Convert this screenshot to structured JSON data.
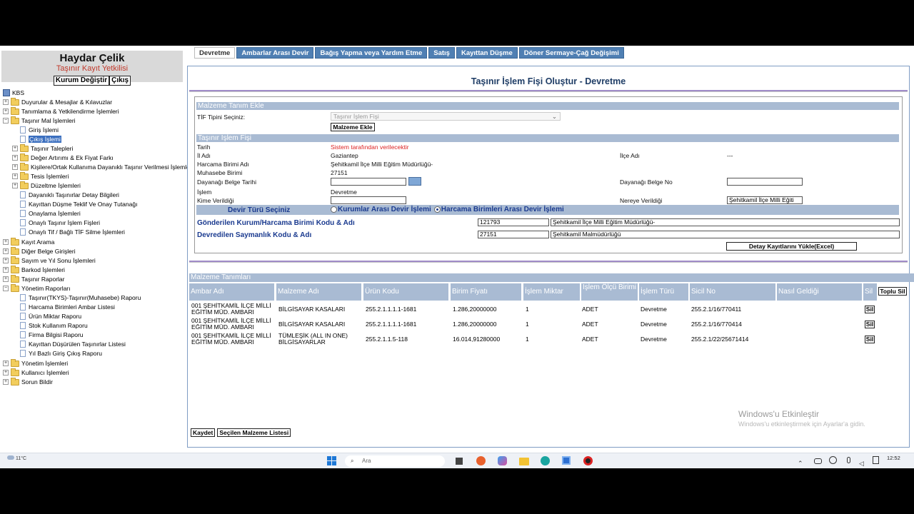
{
  "user": {
    "name": "Haydar Çelik",
    "role": "Taşınır Kayıt Yetkilisi",
    "change_org": "Kurum Değiştir",
    "logout": "Çıkış"
  },
  "tree": {
    "root": "KBS",
    "items": [
      "Duyurular & Mesajlar & Kılavuzlar",
      "Tanımlama & Yetkilendirme İşlemleri",
      "Taşınır Mal İşlemleri",
      "Giriş İşlemi",
      "Çıkış İşlemi",
      "Taşınır Talepleri",
      "Değer Artırımı & Ek Fiyat Farkı",
      "Kişilere/Ortak Kullanıma Dayanıklı Taşınır Verilmesi İşlemleri",
      "Tesis İşlemleri",
      "Düzeltme İşlemleri",
      "Dayanıklı Taşınırlar Detay Bilgileri",
      "Kayıttan Düşme Teklif Ve Onay Tutanağı",
      "Onaylama İşlemleri",
      "Onaylı Taşınır İşlem Fişleri",
      "Onaylı Tif / Bağlı TİF Silme İşlemleri",
      "Kayıt Arama",
      "Diğer Belge Girişleri",
      "Sayım ve Yıl Sonu İşlemleri",
      "Barkod İşlemleri",
      "Taşınır Raporlar",
      "Yönetim Raporları",
      "Taşınır(TKYS)-Taşınır(Muhasebe) Raporu",
      "Harcama Birimleri Ambar Listesi",
      "Ürün Miktar Raporu",
      "Stok Kullanım Raporu",
      "Firma Bilgisi Raporu",
      "Kayıttan Düşürülen Taşınırlar Listesi",
      "Yıl Bazlı Giriş Çıkış Raporu",
      "Yönetim İşlemleri",
      "Kullanıcı İşlemleri",
      "Sorun Bildir"
    ]
  },
  "tabs": [
    "Devretme",
    "Ambarlar Arası Devir",
    "Bağış Yapma veya Yardım Etme",
    "Satış",
    "Kayıttan Düşme",
    "Döner Sermaye-Çağ Değişimi"
  ],
  "form": {
    "title": "Taşınır İşlem Fişi Oluştur - Devretme",
    "sec1": "Malzeme Tanım Ekle",
    "tif_label": "TİF Tipini Seçiniz:",
    "tif_value": "Taşınır İşlem Fişi",
    "add_material": "Malzeme Ekle",
    "sec2": "Taşınır İşlem Fişi",
    "date_label": "Tarih",
    "date_value": "Sistem tarafından verilecektir",
    "city_label": "İl Adı",
    "city_value": "Gaziantep",
    "district_label": "İlçe Adı",
    "district_value": "---",
    "unit_label": "Harcama Birimi Adı",
    "unit_value": "Şehitkamil İlçe Milli Eğitim Müdürlüğü-",
    "acc_label": "Muhasebe Birimi",
    "acc_value": "27151",
    "docdate_label": "Dayanağı Belge Tarihi",
    "docno_label": "Dayanağı Belge No",
    "op_label": "İşlem",
    "op_value": "Devretme",
    "given_label": "Kime Verildiği",
    "where_label": "Nereye Verildiği",
    "where_value": "Şehitkamil İlçe Milli Eğiti",
    "transfer_label": "Devir Türü Seçiniz",
    "radio1": "Kurumlar Arası Devir İşlemi",
    "radio2": "Harcama Birimleri Arası Devir İşlemi",
    "sender_label": "Gönderilen Kurum/Harcama Birimi Kodu & Adı",
    "sender_code": "121793",
    "sender_name": "Şehitkamil İlçe Milli Eğitim Müdürlüğü-",
    "office_label": "Devredilen Saymanlık Kodu & Adı",
    "office_code": "27151",
    "office_name": "Şehitkamil Malmüdürlüğü",
    "excel_btn": "Detay Kayıtlarını Yükle(Excel)"
  },
  "table": {
    "title": "Malzeme Tanımları",
    "headers": [
      "Ambar Adı",
      "Malzeme Adı",
      "Ürün Kodu",
      "Birim Fiyatı",
      "İşlem Miktar",
      "İşlem Ölçü Birimi",
      "İşlem Türü",
      "Sicil No",
      "Nasıl Geldiği",
      "Sil"
    ],
    "bulk_delete": "Toplu Sil",
    "delete_label": "Sil",
    "rows": [
      [
        "001 ŞEHİTKAMİL İLÇE MİLLİ EĞİTİM MÜD. AMBARI",
        "BİLGİSAYAR KASALARI",
        "255.2.1.1.1.1-1681",
        "1.286,20000000",
        "1",
        "ADET",
        "Devretme",
        "255.2.1/16/770411"
      ],
      [
        "001 ŞEHİTKAMİL İLÇE MİLLİ EĞİTİM MÜD. AMBARI",
        "BİLGİSAYAR KASALARI",
        "255.2.1.1.1.1-1681",
        "1.286,20000000",
        "1",
        "ADET",
        "Devretme",
        "255.2.1/16/770414"
      ],
      [
        "001 ŞEHİTKAMİL İLÇE MİLLİ EĞİTİM MÜD. AMBARI",
        "TÜMLEŞİK (ALL IN ONE) BİLGİSAYARLAR",
        "255.2.1.1.5-118",
        "16.014,91280000",
        "1",
        "ADET",
        "Devretme",
        "255.2.1/22/25671414"
      ]
    ]
  },
  "bottom": {
    "save": "Kaydet",
    "selected": "Seçilen Malzeme Listesi"
  },
  "watermark": {
    "line1": "Windows'u Etkinleştir",
    "line2": "Windows'u etkinleştirmek için Ayarlar'a gidin."
  },
  "taskbar": {
    "temp": "11°C",
    "search_placeholder": "Ara",
    "time": "12:52"
  }
}
